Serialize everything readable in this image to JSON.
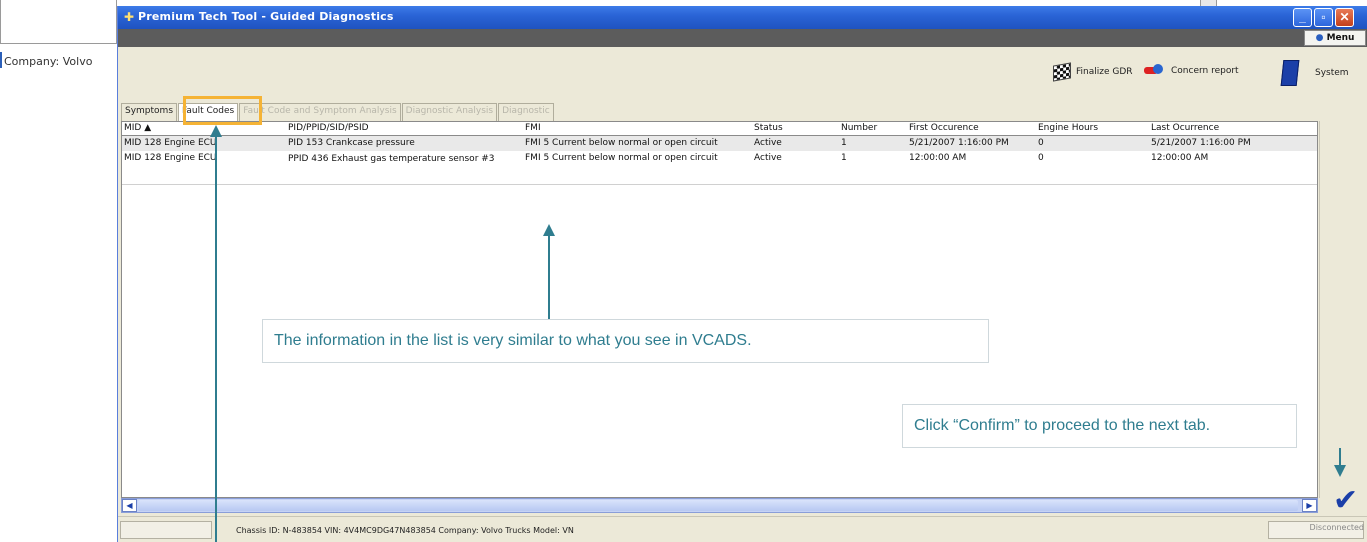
{
  "background": {
    "company_label": "Company: Volvo"
  },
  "window": {
    "title": "Premium Tech Tool - Guided Diagnostics",
    "menu_label": "Menu",
    "controls": {
      "minimize": "_",
      "maximize": "▫",
      "close": "✕"
    }
  },
  "toolbar": {
    "finalize_label": "Finalize GDR",
    "concern_label": "Concern report",
    "system_label": "System"
  },
  "tabs": [
    {
      "label": "Symptoms",
      "state": "normal"
    },
    {
      "label": "Fault Codes",
      "state": "active"
    },
    {
      "label": "Fault Code and Symptom Analysis",
      "state": "disabled"
    },
    {
      "label": "Diagnostic Analysis",
      "state": "disabled"
    },
    {
      "label": "Diagnostic",
      "state": "disabled"
    }
  ],
  "table": {
    "columns": [
      "MID ▲",
      "PID/PPID/SID/PSID",
      "FMI",
      "Status",
      "Number",
      "First Occurence",
      "Engine Hours",
      "Last Ocurrence"
    ],
    "rows": [
      [
        "MID 128 Engine ECU",
        "PID 153 Crankcase pressure",
        "FMI 5 Current below normal or open circuit",
        "Active",
        "1",
        "5/21/2007 1:16:00 PM",
        "0",
        "5/21/2007 1:16:00 PM"
      ],
      [
        "MID 128 Engine ECU",
        "PPID 436 Exhaust gas temperature sensor #3",
        "FMI 5 Current below normal or open circuit",
        "Active",
        "1",
        "12:00:00 AM",
        "0",
        "12:00:00 AM"
      ]
    ]
  },
  "scrollbar": {
    "left_arrow": "◀",
    "right_arrow": "▶"
  },
  "confirm_icon": "check-icon",
  "statusbar": {
    "vehicle_info": "Chassis ID: N-483854   VIN: 4V4MC9DG47N483854   Company: Volvo Trucks   Model: VN",
    "connection": "Disconnected"
  },
  "annotations": {
    "list_info": "The information in the list is very similar to what you see in VCADS.",
    "confirm_info": "Click “Confirm” to proceed to the next tab."
  },
  "colors": {
    "titlebar": "#2a64d6",
    "highlight": "#f5b335",
    "callout_text": "#2f7d8f",
    "window_bg": "#ece9d8"
  }
}
